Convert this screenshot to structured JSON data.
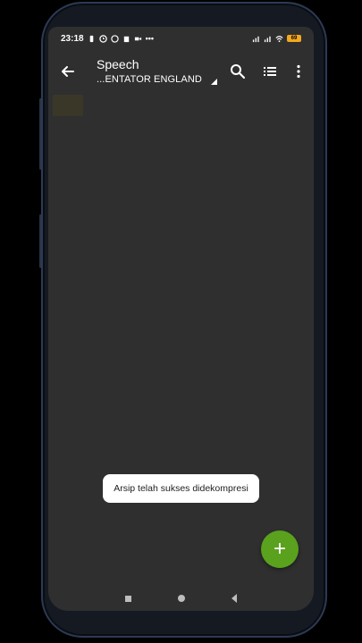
{
  "status_bar": {
    "time": "23:18",
    "battery_level": "69",
    "left_icons": [
      "vibrate-icon",
      "alarm-icon",
      "whatsapp-icon",
      "notification-icon",
      "video-icon",
      "more-dots-icon"
    ],
    "right_icons": [
      "signal-icon",
      "signal-icon",
      "wifi-icon",
      "battery-icon"
    ]
  },
  "app_bar": {
    "title": "Speech",
    "subtitle": "...ENTATOR ENGLAND",
    "actions": [
      "search-icon",
      "list-view-icon",
      "more-vert-icon"
    ]
  },
  "toast": {
    "message": "Arsip telah sukses didekompresi"
  },
  "fab": {
    "label": "+"
  },
  "colors": {
    "background": "#2f2f2f",
    "fab": "#5aa11d",
    "battery": "#f2a81f"
  }
}
